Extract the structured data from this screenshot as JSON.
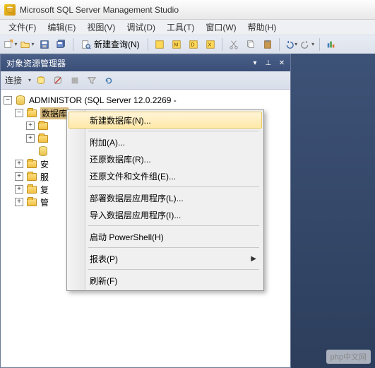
{
  "app": {
    "title": "Microsoft SQL Server Management Studio"
  },
  "menu": {
    "file": "文件(F)",
    "edit": "编辑(E)",
    "view": "视图(V)",
    "debug": "调试(D)",
    "tools": "工具(T)",
    "window": "窗口(W)",
    "help": "帮助(H)"
  },
  "toolbar": {
    "new_query": "新建查询(N)"
  },
  "panel": {
    "title": "对象资源管理器",
    "connect_label": "连接"
  },
  "tree": {
    "server": "ADMINISTOR (SQL Server 12.0.2269 -",
    "databases": "数据库",
    "security": "安",
    "server_objects": "服",
    "replication": "复",
    "management": "管"
  },
  "context_menu": {
    "new_database": "新建数据库(N)...",
    "attach": "附加(A)...",
    "restore_database": "还原数据库(R)...",
    "restore_files": "还原文件和文件组(E)...",
    "deploy_dtac": "部署数据层应用程序(L)...",
    "import_dtac": "导入数据层应用程序(I)...",
    "start_powershell": "启动 PowerShell(H)",
    "reports": "报表(P)",
    "refresh": "刷新(F)"
  },
  "watermark": "php中文网"
}
